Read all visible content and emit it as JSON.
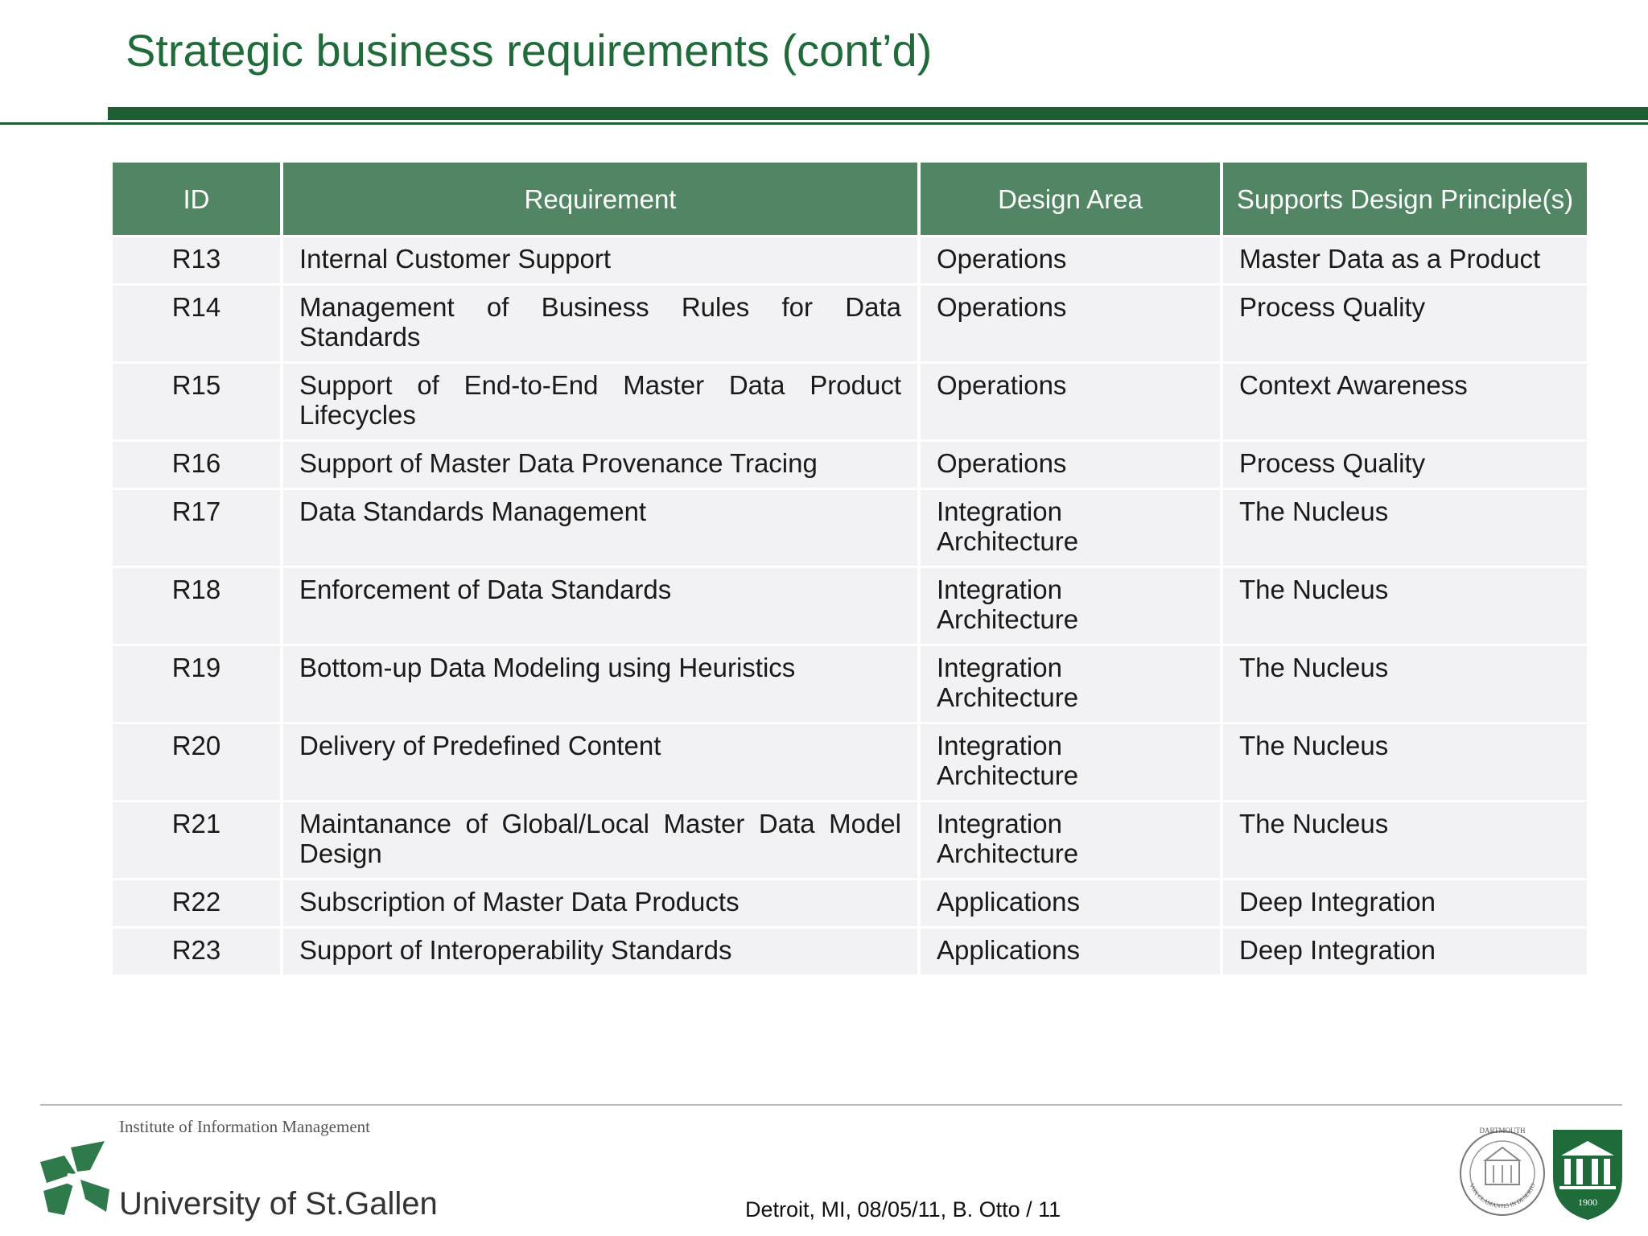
{
  "slide": {
    "title": "Strategic business requirements (cont’d)"
  },
  "table": {
    "headers": {
      "id": "ID",
      "requirement": "Requirement",
      "design_area": "Design Area",
      "principles": "Supports Design Principle(s)"
    },
    "rows": [
      {
        "id": "R13",
        "requirement": "Internal Customer Support",
        "design_area": "Operations",
        "principle": "Master Data as a Product"
      },
      {
        "id": "R14",
        "requirement": "Management of Business Rules for Data Standards",
        "design_area": "Operations",
        "principle": "Process Quality"
      },
      {
        "id": "R15",
        "requirement": "Support of End-to-End Master Data Product Lifecycles",
        "design_area": "Operations",
        "principle": "Context Awareness"
      },
      {
        "id": "R16",
        "requirement": "Support of Master Data Provenance Tracing",
        "design_area": "Operations",
        "principle": "Process Quality"
      },
      {
        "id": "R17",
        "requirement": "Data Standards Management",
        "design_area": "Integration Architecture",
        "principle": "The Nucleus"
      },
      {
        "id": "R18",
        "requirement": "Enforcement of Data Standards",
        "design_area": "Integration Architecture",
        "principle": "The Nucleus"
      },
      {
        "id": "R19",
        "requirement": "Bottom-up Data Modeling using Heuristics",
        "design_area": "Integration Architecture",
        "principle": "The Nucleus"
      },
      {
        "id": "R20",
        "requirement": "Delivery of Predefined Content",
        "design_area": "Integration Architecture",
        "principle": "The Nucleus"
      },
      {
        "id": "R21",
        "requirement": "Maintanance of Global/Local Master Data Model Design",
        "design_area": "Integration Architecture",
        "principle": "The Nucleus"
      },
      {
        "id": "R22",
        "requirement": "Subscription of Master Data Products",
        "design_area": "Applications",
        "principle": "Deep Integration"
      },
      {
        "id": "R23",
        "requirement": "Support of Interoperability Standards",
        "design_area": "Applications",
        "principle": "Deep Integration"
      }
    ]
  },
  "footer": {
    "institute": "Institute of Information Management",
    "university": "University of St.Gallen",
    "info": "Detroit, MI, 08/05/11, B. Otto / 11",
    "left_logo_icon": "st-gallen-logo-icon",
    "right_logo_icons": [
      "dartmouth-seal-icon",
      "dartmouth-shield-icon"
    ],
    "dartmouth_seal_text": [
      "DARTMOUTH",
      "VOX CLAMANTIS IN DESERTO"
    ],
    "dartmouth_shield_text": "1900"
  },
  "colors": {
    "title_green": "#1f6b3a",
    "rule_green": "#1f5e33",
    "header_green": "#528563",
    "row_gray": "#f2f2f4"
  }
}
